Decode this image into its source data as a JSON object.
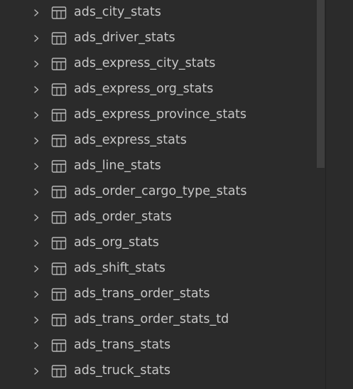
{
  "tree": {
    "items": [
      {
        "label": "ads_city_stats",
        "icon": "table-icon",
        "expand_icon": "chevron-right-icon"
      },
      {
        "label": "ads_driver_stats",
        "icon": "table-icon",
        "expand_icon": "chevron-right-icon"
      },
      {
        "label": "ads_express_city_stats",
        "icon": "table-icon",
        "expand_icon": "chevron-right-icon"
      },
      {
        "label": "ads_express_org_stats",
        "icon": "table-icon",
        "expand_icon": "chevron-right-icon"
      },
      {
        "label": "ads_express_province_stats",
        "icon": "table-icon",
        "expand_icon": "chevron-right-icon"
      },
      {
        "label": "ads_express_stats",
        "icon": "table-icon",
        "expand_icon": "chevron-right-icon"
      },
      {
        "label": "ads_line_stats",
        "icon": "table-icon",
        "expand_icon": "chevron-right-icon"
      },
      {
        "label": "ads_order_cargo_type_stats",
        "icon": "table-icon",
        "expand_icon": "chevron-right-icon"
      },
      {
        "label": "ads_order_stats",
        "icon": "table-icon",
        "expand_icon": "chevron-right-icon"
      },
      {
        "label": "ads_org_stats",
        "icon": "table-icon",
        "expand_icon": "chevron-right-icon"
      },
      {
        "label": "ads_shift_stats",
        "icon": "table-icon",
        "expand_icon": "chevron-right-icon"
      },
      {
        "label": "ads_trans_order_stats",
        "icon": "table-icon",
        "expand_icon": "chevron-right-icon"
      },
      {
        "label": "ads_trans_order_stats_td",
        "icon": "table-icon",
        "expand_icon": "chevron-right-icon"
      },
      {
        "label": "ads_trans_stats",
        "icon": "table-icon",
        "expand_icon": "chevron-right-icon"
      },
      {
        "label": "ads_truck_stats",
        "icon": "table-icon",
        "expand_icon": "chevron-right-icon"
      }
    ]
  },
  "colors": {
    "background": "#2b2b2b",
    "text": "#c6c6c6",
    "icon": "#b8b8b8",
    "scrollbar_thumb": "#3f3f3f",
    "divider": "#222222"
  }
}
